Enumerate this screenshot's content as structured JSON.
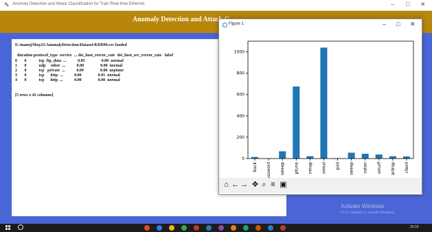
{
  "window": {
    "title": "Anomaly Detection and Attack Classification for Train Real-time Ethernet",
    "minimize": "–",
    "maximize": "□",
    "close": "✕"
  },
  "header": {
    "title": "Anomaly Detection and Attack C"
  },
  "output": {
    "loaded_line": "E:/manoj/May21/AnomalyDetection/Dataset/KDD99.csv loaded",
    "table_header": "  duration protocol_type  service  ... dst_host_rerror_rate  dst_host_srv_rerror_rate   label",
    "rows": [
      "0       0            tcp  ftp_data  ...           0.05                0.00  normal",
      "1       0            udp     other  ...           0.00                0.00  normal",
      "2       0            tcp   private  ...           0.00                0.00  neptune",
      "3       0            tcp      http  ...           0.00                0.01  normal",
      "4       0            tcp      http  ...           0.00                0.00  normal"
    ],
    "summary": "[5 rows x 42 columns]"
  },
  "figure": {
    "title": "Figure 1",
    "minimize": "–",
    "maximize": "□",
    "close": "✕"
  },
  "chart_data": {
    "type": "bar",
    "categories": [
      "back",
      "assword",
      "sweep",
      "ptune",
      "nmap",
      "ormal",
      "pod",
      "sweep",
      "satan",
      "smurf",
      "ardrop",
      "client"
    ],
    "values": [
      15,
      3,
      68,
      675,
      22,
      1040,
      4,
      55,
      45,
      38,
      22,
      20
    ],
    "yticks": [
      0,
      200,
      400,
      600,
      800,
      1000
    ],
    "ylim": [
      0,
      1100
    ],
    "bar_color": "#1f77b4",
    "title": "",
    "xlabel": "",
    "ylabel": ""
  },
  "toolbar_icons": [
    "home-icon",
    "back-arrow-icon",
    "forward-arrow-icon",
    "pan-icon",
    "zoom-icon",
    "configure-icon",
    "save-icon"
  ],
  "watermark": {
    "line1": "Activate Windows",
    "line2": "Go to Settings to activate Windows."
  },
  "taskbar": {
    "time": "20:16"
  }
}
